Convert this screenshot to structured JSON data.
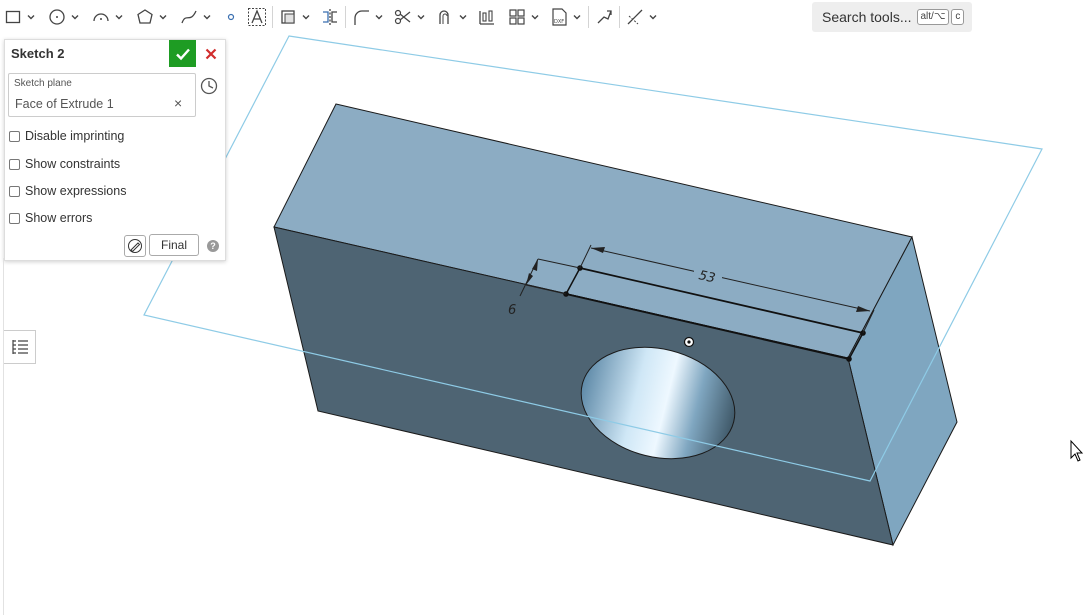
{
  "toolbar": {
    "tools": [
      "rectangle-icon",
      "circle-icon",
      "arc-icon",
      "polygon-icon",
      "spline-icon",
      "point-icon",
      "text-icon",
      "use-icon",
      "mirror-icon",
      "fillet-icon",
      "trim-icon",
      "offset-icon",
      "pattern-icon",
      "transform-icon",
      "dxf-icon",
      "construction-icon",
      "dimension-icon"
    ],
    "search_label": "Search tools...",
    "search_shortcut_1": "alt/⌥",
    "search_shortcut_2": "c"
  },
  "panel": {
    "title": "Sketch 2",
    "plane_label": "Sketch plane",
    "plane_value": "Face of Extrude 1",
    "plane_clear": "×",
    "options": [
      {
        "label": "Disable imprinting",
        "checked": false
      },
      {
        "label": "Show constraints",
        "checked": false
      },
      {
        "label": "Show expressions",
        "checked": false
      },
      {
        "label": "Show errors",
        "checked": false
      }
    ],
    "final_label": "Final",
    "help": "?"
  },
  "viewport": {
    "dimension_length": "53",
    "dimension_offset": "6",
    "colors": {
      "top_face": "#8cacc3",
      "front_face": "#4e6473",
      "side_face": "#7fa6c0",
      "plane_outline": "#8ecbe6",
      "accept": "#1e9c23",
      "cancel": "#d12c2c"
    }
  }
}
